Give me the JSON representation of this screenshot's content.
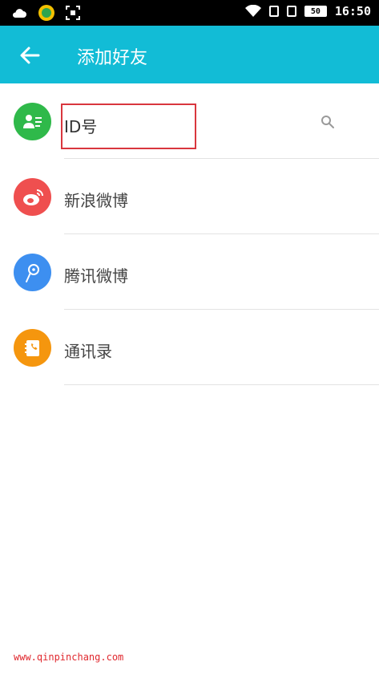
{
  "status_bar": {
    "time": "16:50",
    "battery_level": "50",
    "icons": [
      "cloud-icon",
      "coin-app-icon",
      "screenshot-icon",
      "wifi-icon",
      "sim-icon",
      "sim-icon",
      "battery-icon"
    ]
  },
  "header": {
    "title": "添加好友",
    "back_icon": "arrow-left-icon"
  },
  "list": {
    "items": [
      {
        "label": "ID号",
        "icon": "contact-card-icon",
        "color": "#2fb94a",
        "trailing_icon": "search-icon"
      },
      {
        "label": "新浪微博",
        "icon": "weibo-icon",
        "color": "#ef4f4f"
      },
      {
        "label": "腾讯微博",
        "icon": "tencent-weibo-icon",
        "color": "#3d8ff0"
      },
      {
        "label": "通讯录",
        "icon": "address-book-icon",
        "color": "#f5960e"
      }
    ]
  },
  "highlight_color": "#d9363e",
  "accent_color": "#12bcd6",
  "watermark": "www.qinpinchang.com"
}
